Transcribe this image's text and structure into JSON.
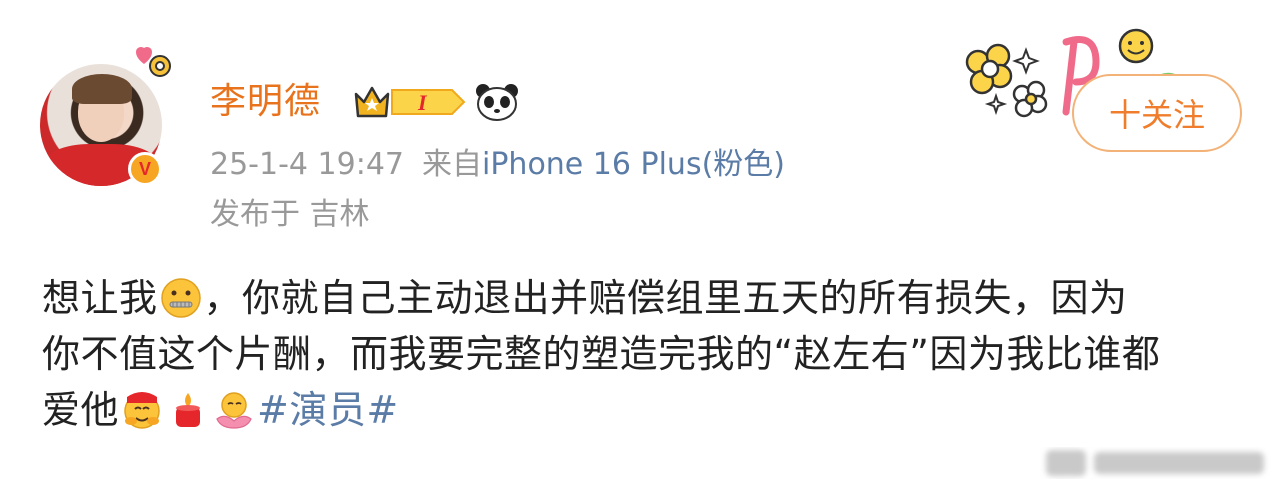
{
  "user": {
    "name": "李明德",
    "verified_badge": "V",
    "level_badge": "I"
  },
  "meta": {
    "timestamp": "25-1-4 19:47",
    "from_label": "来自",
    "device": "iPhone 16 Plus(粉色)",
    "location": "发布于 吉林"
  },
  "follow_button": {
    "label": "十关注"
  },
  "post": {
    "line1_a": "想让我",
    "line1_b": "，你就自己主动退出并赔偿组里五天的所有损失，因为",
    "line2": "你不值这个片酬，而我要完整的塑造完我的“赵左右”因为我比谁都",
    "line3_a": "爱他",
    "hashtag": "#演员#"
  },
  "colors": {
    "username": "#e8731c",
    "link": "#5b7ca6",
    "meta": "#999999",
    "follow_border": "#f3b277",
    "follow_text": "#ef7d2b"
  },
  "icons": [
    "avatar-pendant-icon",
    "crown-level-icon",
    "panda-icon",
    "zipper-mouth-emoji",
    "hug-emoji",
    "candle-emoji",
    "lotus-emoji"
  ]
}
